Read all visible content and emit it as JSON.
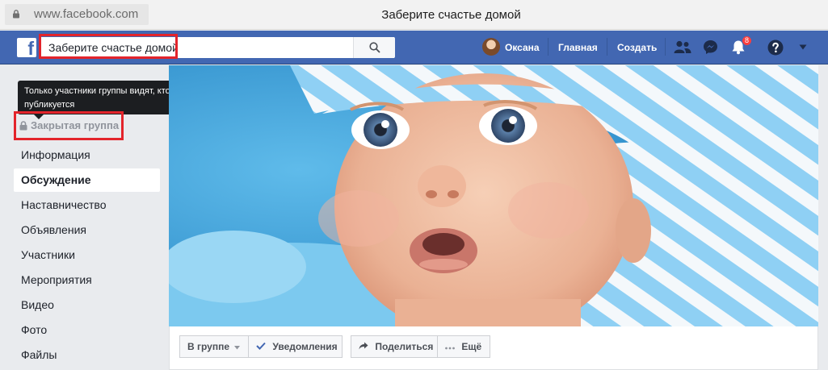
{
  "browser": {
    "url": "www.facebook.com",
    "window_title": "Заберите счастье домой"
  },
  "topbar": {
    "search_value": "Заберите счастье домой",
    "user_name": "Оксана",
    "home_label": "Главная",
    "create_label": "Создать",
    "notifications_count": "8",
    "accent_color": "#4267b2"
  },
  "sidebar": {
    "tooltip_text": "Только участники группы видят, кто в ней состоит и что публикуется",
    "privacy_label": "Закрытая группа",
    "items": [
      {
        "label": "Информация"
      },
      {
        "label": "Обсуждение",
        "active": true
      },
      {
        "label": "Наставничество"
      },
      {
        "label": "Объявления"
      },
      {
        "label": "Участники"
      },
      {
        "label": "Мероприятия"
      },
      {
        "label": "Видео"
      },
      {
        "label": "Фото"
      },
      {
        "label": "Файлы"
      }
    ]
  },
  "actions": {
    "in_group": "В группе",
    "notifications": "Уведомления",
    "share": "Поделиться",
    "more": "Ещё"
  },
  "highlight_color": "#e3242b"
}
